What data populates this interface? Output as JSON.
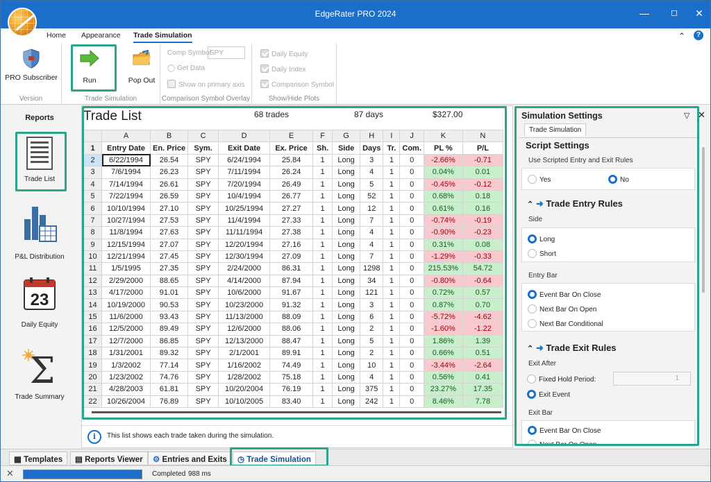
{
  "window": {
    "title": "EdgeRater PRO 2024"
  },
  "menu": {
    "items": [
      "Home",
      "Appearance",
      "Trade Simulation"
    ]
  },
  "ribbon": {
    "version_btn": "PRO Subscriber",
    "version_group": "Version",
    "run_btn": "Run",
    "popout_btn": "Pop Out",
    "sim_group": "Trade Simulation",
    "comp_symbol_label": "Comp Symbol",
    "comp_symbol_value": "SPY",
    "get_data": "Get Data",
    "show_primary": "Show on primary axis",
    "overlay_group": "Comparison Symbol Overlay",
    "daily_equity": "Daily Equity",
    "daily_index": "Daily Index",
    "comparison_symbol": "Comparison Symbol",
    "plots_group": "Show/Hide Plots"
  },
  "reports": {
    "heading": "Reports",
    "items": [
      "Trade List",
      "P&L Distribution",
      "Daily Equity",
      "Trade Summary"
    ],
    "calendar_day": "23"
  },
  "tradelist": {
    "title": "Trade List",
    "trades": "68 trades",
    "days": "87 days",
    "total": "$327.00",
    "col_letters": [
      "A",
      "B",
      "C",
      "D",
      "E",
      "F",
      "G",
      "H",
      "I",
      "J",
      "K",
      "N"
    ],
    "headers": [
      "Entry Date",
      "En. Price",
      "Sym.",
      "Exit Date",
      "Ex. Price",
      "Sh.",
      "Side",
      "Days",
      "Tr.",
      "Com.",
      "PL %",
      "P/L"
    ],
    "rows": [
      [
        "6/22/1994",
        "26.54",
        "SPY",
        "6/24/1994",
        "25.84",
        "1",
        "Long",
        "3",
        "1",
        "0",
        "-2.66%",
        "-0.71"
      ],
      [
        "7/6/1994",
        "26.23",
        "SPY",
        "7/11/1994",
        "26.24",
        "1",
        "Long",
        "4",
        "1",
        "0",
        "0.04%",
        "0.01"
      ],
      [
        "7/14/1994",
        "26.61",
        "SPY",
        "7/20/1994",
        "26.49",
        "1",
        "Long",
        "5",
        "1",
        "0",
        "-0.45%",
        "-0.12"
      ],
      [
        "7/22/1994",
        "26.59",
        "SPY",
        "10/4/1994",
        "26.77",
        "1",
        "Long",
        "52",
        "1",
        "0",
        "0.68%",
        "0.18"
      ],
      [
        "10/10/1994",
        "27.10",
        "SPY",
        "10/25/1994",
        "27.27",
        "1",
        "Long",
        "12",
        "1",
        "0",
        "0.61%",
        "0.16"
      ],
      [
        "10/27/1994",
        "27.53",
        "SPY",
        "11/4/1994",
        "27.33",
        "1",
        "Long",
        "7",
        "1",
        "0",
        "-0.74%",
        "-0.19"
      ],
      [
        "11/8/1994",
        "27.63",
        "SPY",
        "11/11/1994",
        "27.38",
        "1",
        "Long",
        "4",
        "1",
        "0",
        "-0.90%",
        "-0.23"
      ],
      [
        "12/15/1994",
        "27.07",
        "SPY",
        "12/20/1994",
        "27.16",
        "1",
        "Long",
        "4",
        "1",
        "0",
        "0.31%",
        "0.08"
      ],
      [
        "12/21/1994",
        "27.45",
        "SPY",
        "12/30/1994",
        "27.09",
        "1",
        "Long",
        "7",
        "1",
        "0",
        "-1.29%",
        "-0.33"
      ],
      [
        "1/5/1995",
        "27.35",
        "SPY",
        "2/24/2000",
        "86.31",
        "1",
        "Long",
        "1298",
        "1",
        "0",
        "215.53%",
        "54.72"
      ],
      [
        "2/29/2000",
        "88.65",
        "SPY",
        "4/14/2000",
        "87.94",
        "1",
        "Long",
        "34",
        "1",
        "0",
        "-0.80%",
        "-0.64"
      ],
      [
        "4/17/2000",
        "91.01",
        "SPY",
        "10/6/2000",
        "91.67",
        "1",
        "Long",
        "121",
        "1",
        "0",
        "0.72%",
        "0.57"
      ],
      [
        "10/19/2000",
        "90.53",
        "SPY",
        "10/23/2000",
        "91.32",
        "1",
        "Long",
        "3",
        "1",
        "0",
        "0.87%",
        "0.70"
      ],
      [
        "11/6/2000",
        "93.43",
        "SPY",
        "11/13/2000",
        "88.09",
        "1",
        "Long",
        "6",
        "1",
        "0",
        "-5.72%",
        "-4.62"
      ],
      [
        "12/5/2000",
        "89.49",
        "SPY",
        "12/6/2000",
        "88.06",
        "1",
        "Long",
        "2",
        "1",
        "0",
        "-1.60%",
        "-1.22"
      ],
      [
        "12/7/2000",
        "86.85",
        "SPY",
        "12/13/2000",
        "88.47",
        "1",
        "Long",
        "5",
        "1",
        "0",
        "1.86%",
        "1.39"
      ],
      [
        "1/31/2001",
        "89.32",
        "SPY",
        "2/1/2001",
        "89.91",
        "1",
        "Long",
        "2",
        "1",
        "0",
        "0.66%",
        "0.51"
      ],
      [
        "1/3/2002",
        "77.14",
        "SPY",
        "1/16/2002",
        "74.49",
        "1",
        "Long",
        "10",
        "1",
        "0",
        "-3.44%",
        "-2.64"
      ],
      [
        "1/23/2002",
        "74.76",
        "SPY",
        "1/28/2002",
        "75.18",
        "1",
        "Long",
        "4",
        "1",
        "0",
        "0.56%",
        "0.41"
      ],
      [
        "4/28/2003",
        "61.81",
        "SPY",
        "10/20/2004",
        "76.19",
        "1",
        "Long",
        "375",
        "1",
        "0",
        "23.27%",
        "17.35"
      ],
      [
        "10/26/2004",
        "76.89",
        "SPY",
        "10/10/2005",
        "83.40",
        "1",
        "Long",
        "242",
        "1",
        "0",
        "8.46%",
        "7.78"
      ]
    ],
    "info": "This list shows each trade taken during the simulation."
  },
  "settings": {
    "title": "Simulation Settings",
    "tab": "Trade Simulation",
    "script_settings": "Script Settings",
    "use_scripted": "Use Scripted Entry and Exit Rules",
    "yes": "Yes",
    "no": "No",
    "entry_rules": "Trade Entry Rules",
    "side": "Side",
    "long": "Long",
    "short": "Short",
    "entry_bar": "Entry Bar",
    "event_bar_close": "Event Bar On Close",
    "next_bar_open": "Next Bar On Open",
    "next_bar_conditional": "Next Bar Conditional",
    "exit_rules": "Trade Exit Rules",
    "exit_after": "Exit After",
    "fixed_hold": "Fixed Hold Period:",
    "fixed_hold_value": "1",
    "exit_event": "Exit Event",
    "exit_bar": "Exit Bar",
    "exit_event_bar_close": "Event Bar On Close",
    "exit_next_bar_open": "Next Bar On Open"
  },
  "bottomtabs": [
    "Templates",
    "Reports Viewer",
    "Entries and Exits",
    "Trade Simulation"
  ],
  "status": {
    "text": "Completed",
    "time": "988 ms",
    "progress": 1.0
  },
  "colors": {
    "accent": "#1c6fc9",
    "highlight": "#2aa58c",
    "neg": "#f8c9cf",
    "pos": "#c9eecb"
  }
}
